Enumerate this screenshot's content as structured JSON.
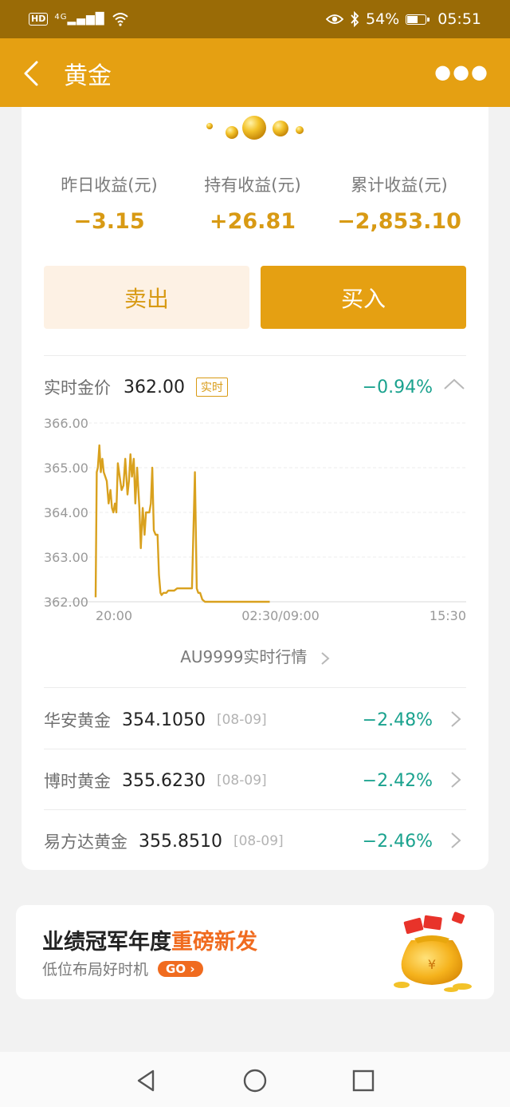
{
  "status_bar": {
    "hd": "HD",
    "network": "4G",
    "battery": "54%",
    "time": "05:51"
  },
  "header": {
    "title": "黄金"
  },
  "stats": [
    {
      "label": "昨日收益(元)",
      "value": "−3.15"
    },
    {
      "label": "持有收益(元)",
      "value": "+26.81"
    },
    {
      "label": "累计收益(元)",
      "value": "−2,853.10"
    }
  ],
  "actions": {
    "sell": "卖出",
    "buy": "买入"
  },
  "realtime": {
    "label": "实时金价",
    "price": "362.00",
    "tag": "实时",
    "change": "−0.94%"
  },
  "chart_data": {
    "type": "line",
    "y_ticks": [
      "366.00",
      "365.00",
      "364.00",
      "363.00",
      "362.00"
    ],
    "x_ticks": [
      "20:00",
      "02:30/09:00",
      "15:30"
    ],
    "ylim": [
      362,
      366
    ],
    "x_range": [
      0,
      100
    ],
    "grid": true,
    "color": "#d9a11e",
    "series": [
      {
        "x": [
          0,
          0.3,
          0.6,
          1.0,
          1.4,
          1.8,
          2.2,
          3.0,
          3.5,
          4.0,
          4.4,
          4.8,
          5.2,
          5.6,
          6.0,
          6.5,
          7.0,
          7.5,
          8.0,
          8.6,
          9.0,
          9.4,
          9.8,
          10.3,
          10.7,
          11.2,
          11.8,
          12.2,
          12.7,
          13.2,
          13.6,
          14.0,
          14.5,
          14.9,
          15.3,
          15.7,
          16.2,
          16.7,
          17.1,
          17.5,
          17.8,
          18.3,
          18.7,
          19.1,
          19.6,
          20.3,
          21.2,
          22.0,
          23.0,
          24.0,
          25.0,
          26.0,
          26.8,
          27.3,
          27.7,
          28.2,
          28.8,
          29.5,
          30.0,
          30.7,
          31.5,
          33.0,
          35.0,
          38.0,
          41.0,
          44.0,
          47.0
        ],
        "y": [
          362.1,
          364.9,
          365.0,
          365.5,
          364.9,
          365.2,
          364.9,
          364.7,
          364.2,
          364.5,
          364.1,
          364.0,
          364.2,
          364.0,
          365.1,
          364.8,
          364.5,
          364.6,
          365.2,
          364.4,
          364.7,
          365.3,
          364.8,
          365.2,
          364.2,
          365.0,
          364.1,
          363.2,
          364.1,
          363.5,
          364.0,
          364.0,
          364.0,
          364.2,
          365.0,
          363.6,
          363.5,
          363.5,
          362.6,
          362.2,
          362.15,
          362.2,
          362.2,
          362.2,
          362.25,
          362.25,
          362.25,
          362.3,
          362.3,
          362.3,
          362.3,
          362.3,
          364.9,
          362.3,
          362.2,
          362.2,
          362.05,
          362.0,
          362.0,
          362.0,
          362.0,
          362.0,
          362.0,
          362.0,
          362.0,
          362.0,
          362.0
        ]
      }
    ]
  },
  "au_link": "AU9999实时行情",
  "funds": [
    {
      "name": "华安黄金",
      "nav": "354.1050",
      "date": "[08-09]",
      "change": "−2.48%"
    },
    {
      "name": "博时黄金",
      "nav": "355.6230",
      "date": "[08-09]",
      "change": "−2.42%"
    },
    {
      "name": "易方达黄金",
      "nav": "355.8510",
      "date": "[08-09]",
      "change": "−2.46%"
    }
  ],
  "banner": {
    "title_a": "业绩冠军年度",
    "title_b": "重磅新发",
    "subtitle": "低位布局好时机",
    "go": "GO"
  },
  "colors": {
    "accent": "#e5a012",
    "status_bar": "#9a6b06",
    "down_green": "#1aa28e",
    "value_gold": "#d89a14",
    "banner_orange": "#f06b1f"
  },
  "icons": [
    "back-arrow-icon",
    "more-dots-icon",
    "wifi-icon",
    "eye-icon",
    "bluetooth-icon",
    "battery-icon",
    "collapse-chevron-icon",
    "chevron-right-icon",
    "money-bag-icon",
    "nav-back-icon",
    "nav-home-icon",
    "nav-recents-icon"
  ]
}
